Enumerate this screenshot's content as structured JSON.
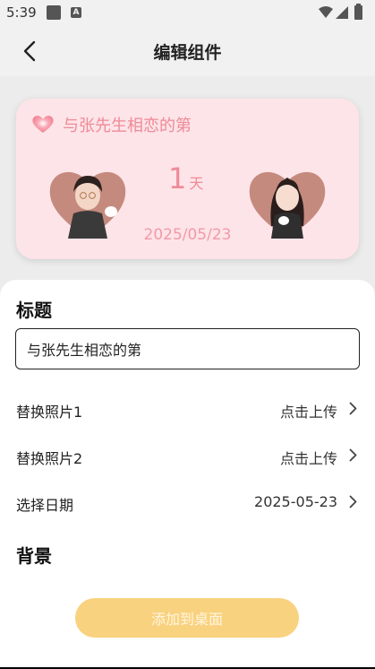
{
  "status_bar": {
    "time": "5:39",
    "icons": [
      "notification-square-icon",
      "a-icon",
      "wifi-icon",
      "signal-icon",
      "battery-icon"
    ]
  },
  "header": {
    "title": "编辑组件"
  },
  "preview": {
    "title": "与张先生相恋的第",
    "days_number": "1",
    "days_unit": "天",
    "date": "2025/05/23",
    "colors": {
      "card_bg": "#fde4e8",
      "accent": "#ef8a98"
    }
  },
  "form": {
    "title_section": "标题",
    "title_value": "与张先生相恋的第",
    "rows": [
      {
        "label": "替换照片1",
        "value": "点击上传"
      },
      {
        "label": "替换照片2",
        "value": "点击上传"
      },
      {
        "label": "选择日期",
        "value": "2025-05-23"
      }
    ],
    "background_section": "背景"
  },
  "actions": {
    "add_label": "添加到桌面",
    "button_color": "#f9d27f"
  }
}
